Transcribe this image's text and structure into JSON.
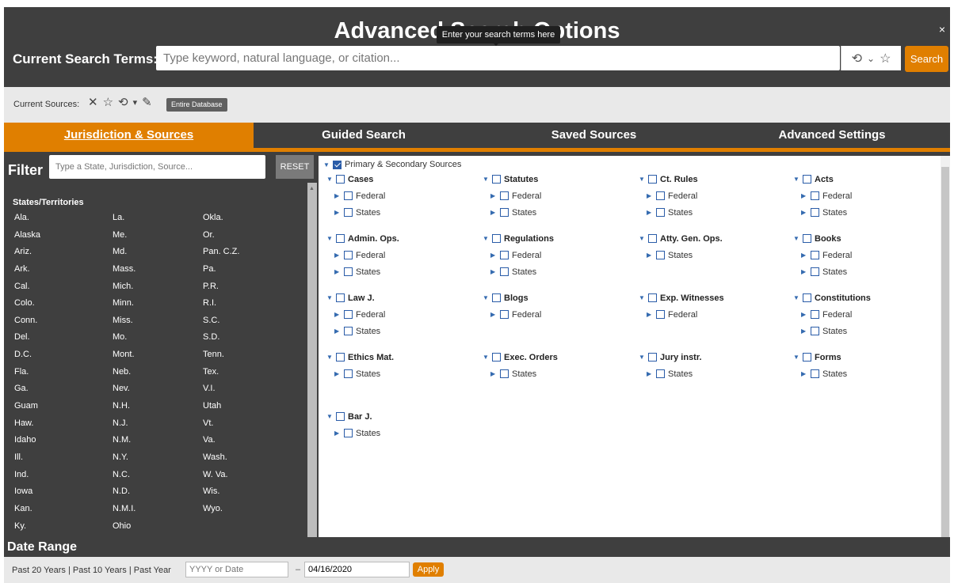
{
  "header": {
    "title": "Advanced Search Options",
    "tooltip": "Enter your search terms here",
    "close_label": "×",
    "terms_label": "Current Search Terms:",
    "search_placeholder": "Type keyword, natural language, or citation...",
    "search_value": "",
    "history_icon": "⟲",
    "dropdown_icon": "⌄",
    "favorite_icon": "☆",
    "search_button": "Search"
  },
  "sources": {
    "label": "Current Sources:",
    "clear_icon": "✕",
    "favorite_icon": "☆",
    "history_icon": "⟲",
    "dropdown_icon": "▾",
    "edit_icon": "✎",
    "chip": "Entire Database"
  },
  "tabs": [
    {
      "label": "Jurisdiction & Sources",
      "active": true
    },
    {
      "label": "Guided Search",
      "active": false
    },
    {
      "label": "Saved Sources",
      "active": false
    },
    {
      "label": "Advanced Settings",
      "active": false
    }
  ],
  "filter": {
    "label": "Filter",
    "placeholder": "Type a State, Jurisdiction, Source...",
    "reset_button": "RESET",
    "states_heading": "States/Territories",
    "states": [
      "Ala.",
      "La.",
      "Okla.",
      "Alaska",
      "Me.",
      "Or.",
      "Ariz.",
      "Md.",
      "Pan. C.Z.",
      "Ark.",
      "Mass.",
      "Pa.",
      "Cal.",
      "Mich.",
      "P.R.",
      "Colo.",
      "Minn.",
      "R.I.",
      "Conn.",
      "Miss.",
      "S.C.",
      "Del.",
      "Mo.",
      "S.D.",
      "D.C.",
      "Mont.",
      "Tenn.",
      "Fla.",
      "Neb.",
      "Tex.",
      "Ga.",
      "Nev.",
      "V.I.",
      "Guam",
      "N.H.",
      "Utah",
      "Haw.",
      "N.J.",
      "Vt.",
      "Idaho",
      "N.M.",
      "Va.",
      "Ill.",
      "N.Y.",
      "Wash.",
      "Ind.",
      "N.C.",
      "W. Va.",
      "Iowa",
      "N.D.",
      "Wis.",
      "Kan.",
      "N.M.I.",
      "Wyo.",
      "Ky.",
      "Ohio",
      ""
    ]
  },
  "tree": {
    "root_label": "Primary & Secondary Sources",
    "root_checked": true,
    "categories": [
      {
        "label": "Cases",
        "subs": [
          "Federal",
          "States"
        ]
      },
      {
        "label": "Statutes",
        "subs": [
          "Federal",
          "States"
        ]
      },
      {
        "label": "Ct. Rules",
        "subs": [
          "Federal",
          "States"
        ]
      },
      {
        "label": "Acts",
        "subs": [
          "Federal",
          "States"
        ]
      },
      {
        "label": "Admin. Ops.",
        "subs": [
          "Federal",
          "States"
        ]
      },
      {
        "label": "Regulations",
        "subs": [
          "Federal",
          "States"
        ]
      },
      {
        "label": "Atty. Gen. Ops.",
        "subs": [
          "States"
        ]
      },
      {
        "label": "Books",
        "subs": [
          "Federal",
          "States"
        ]
      },
      {
        "label": "Law J.",
        "subs": [
          "Federal",
          "States"
        ]
      },
      {
        "label": "Blogs",
        "subs": [
          "Federal"
        ]
      },
      {
        "label": "Exp. Witnesses",
        "subs": [
          "Federal"
        ]
      },
      {
        "label": "Constitutions",
        "subs": [
          "Federal",
          "States"
        ]
      },
      {
        "label": "Ethics Mat.",
        "subs": [
          "States"
        ]
      },
      {
        "label": "Exec. Orders",
        "subs": [
          "States"
        ]
      },
      {
        "label": "Jury instr.",
        "subs": [
          "States"
        ]
      },
      {
        "label": "Forms",
        "subs": [
          "States"
        ]
      },
      {
        "label": "Bar J.",
        "subs": [
          "States"
        ]
      }
    ]
  },
  "date_range": {
    "label": "Date Range",
    "preset_20": "Past 20 Years",
    "preset_10": "Past 10 Years",
    "preset_1": "Past Year",
    "separator": "|",
    "start_placeholder": "YYYY or Date",
    "start_value": "",
    "dash": "–",
    "end_value": "04/16/2020",
    "apply_button": "Apply"
  },
  "colors": {
    "accent": "#e07f00",
    "dark_bg": "#3f3f3f",
    "checkbox": "#2a5ca8"
  }
}
